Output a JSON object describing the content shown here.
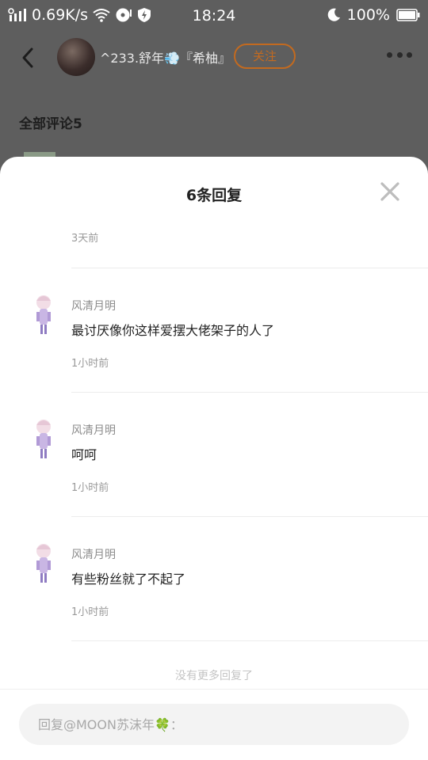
{
  "status_bar": {
    "speed": "0.69K/s",
    "time": "18:24",
    "battery": "100%",
    "icons": [
      "signal-icon",
      "wifi-icon",
      "media-icon",
      "shield-bolt-icon",
      "moon-icon",
      "battery-icon"
    ]
  },
  "header": {
    "author": "^233.舒年💨『希柚』",
    "follow_label": "关注"
  },
  "comments_header": "全部评论5",
  "sheet": {
    "title": "6条回复",
    "first_time": "3天前",
    "replies": [
      {
        "name": "风清月明",
        "text": "最讨厌像你这样爱摆大佬架子的人了",
        "time": "1小时前"
      },
      {
        "name": "风清月明",
        "text": "呵呵",
        "time": "1小时前"
      },
      {
        "name": "风清月明",
        "text": "有些粉丝就了不起了",
        "time": "1小时前"
      }
    ],
    "no_more": "没有更多回复了",
    "input_placeholder": "回复@MOON苏沫年🍀："
  },
  "colors": {
    "accent": "#c36a1f",
    "overlay_bg": "#5e5e5e",
    "sheet_bg": "#ffffff"
  }
}
